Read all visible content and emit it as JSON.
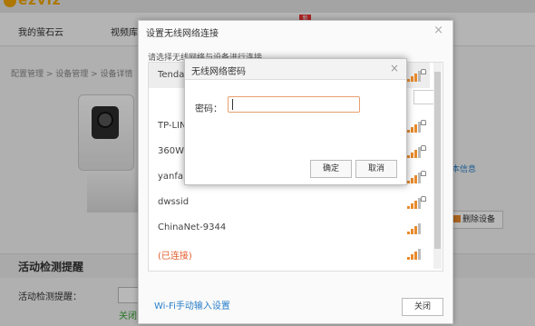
{
  "brand": {
    "name": "ezviz"
  },
  "nav": {
    "items": [
      "我的萤石云",
      "视频库"
    ],
    "new_badge": "新"
  },
  "page": {
    "breadcrumb": "配置管理 > 设备管理 > 设备详情",
    "device_info_link": "本信息",
    "delete_button": "删除设备",
    "motion_section_title": "活动检测提醒",
    "motion_row_label": "活动检测提醒：",
    "motion_status": "关闭"
  },
  "wifi_dialog": {
    "title": "设置无线网络连接",
    "hint": "请选择无线网络与设备进行连接",
    "networks": [
      {
        "name": "Tenda_",
        "status": "selected"
      },
      {
        "name": "TP-LIN",
        "status": "normal"
      },
      {
        "name": "360WI",
        "status": "normal"
      },
      {
        "name": "yanfa",
        "status": "normal"
      },
      {
        "name": "dwssid",
        "status": "normal"
      },
      {
        "name": "ChinaNet-9344",
        "status": "normal"
      },
      {
        "name": "(已连接)",
        "status": "connected"
      }
    ],
    "manual_link": "Wi-Fi手动输入设置",
    "close_button": "关闭"
  },
  "password_dialog": {
    "title": "无线网络密码",
    "label": "密码：",
    "input_value": "",
    "ok_button": "确定",
    "cancel_button": "取消"
  },
  "colors": {
    "accent_orange": "#e98a2b",
    "link_blue": "#2a7fc9",
    "status_green": "#3aa33a",
    "warn_red": "#e25d2c"
  }
}
